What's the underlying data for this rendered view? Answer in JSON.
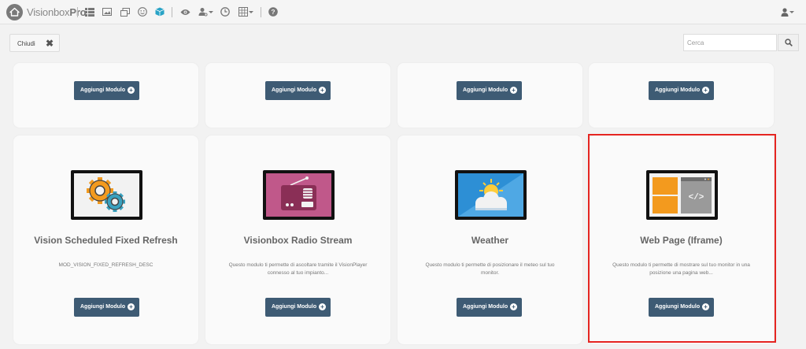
{
  "app": {
    "brand_light": "Visionbox",
    "brand_bold": "Pro"
  },
  "toolbar_icons": [
    "list-icon",
    "image-icon",
    "copy-icon",
    "smile-icon",
    "cube-icon",
    "eye-icon",
    "user-settings-icon",
    "clock-icon",
    "grid-icon",
    "help-icon",
    "user-icon"
  ],
  "actions": {
    "close_label": "Chiudi",
    "search_placeholder": "Cerca"
  },
  "top_row": {
    "add_label": "Aggiungi Modulo"
  },
  "modules": [
    {
      "title": "Vision Scheduled Fixed Refresh",
      "description": "MOD_VISION_FIXED_REFRESH_DESC",
      "add_label": "Aggiungi Modulo",
      "icon": "gears-icon"
    },
    {
      "title": "Visionbox Radio Stream",
      "description": "Questo modulo ti permette di ascoltare tramite il VisionPlayer connesso al tuo impianto...",
      "add_label": "Aggiungi Modulo",
      "icon": "radio-icon"
    },
    {
      "title": "Weather",
      "description": "Questo modulo ti permette di posizionare il meteo sul tuo monitor.",
      "add_label": "Aggiungi Modulo",
      "icon": "weather-icon"
    },
    {
      "title": "Web Page (Iframe)",
      "description": "Questo modulo ti permette di mostrare sul tuo monitor in una posizione una pagina web...",
      "add_label": "Aggiungi Modulo",
      "icon": "webpage-code-icon"
    }
  ],
  "colors": {
    "button": "#3e5b74",
    "highlight": "#e52521",
    "accent_cube": "#29a3c6"
  }
}
